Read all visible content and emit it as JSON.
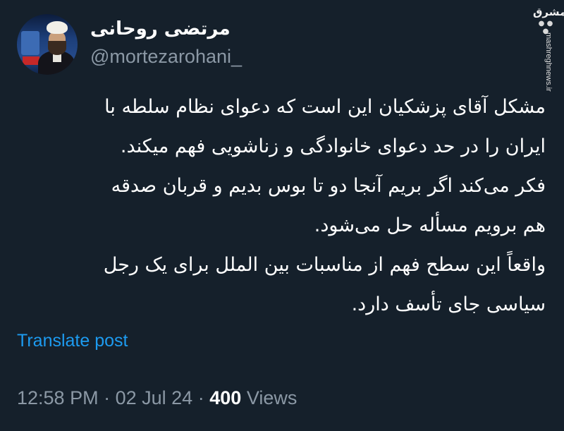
{
  "author": {
    "display_name": "مرتضی روحانی",
    "handle": "@mortezarohani_"
  },
  "watermark": {
    "logo": "مشرق",
    "url": "mashreghnews.ir"
  },
  "post": {
    "lines": [
      "مشکل آقای پزشکیان این است که دعوای نظام سلطه با",
      "ایران را در حد دعوای خانوادگی و زناشویی فهم میکند.",
      "فکر می‌کند اگر بریم آنجا دو تا بوس بدیم و قربان صدقه",
      "هم برویم مسأله حل می‌شود.",
      "واقعاً این سطح فهم از مناسبات بین الملل برای یک رجل",
      "سیاسی جای تأسف دارد."
    ]
  },
  "translate_label": "Translate post",
  "meta": {
    "time": "12:58 PM",
    "separator": "·",
    "date": "02 Jul 24",
    "views_count": "400",
    "views_label": "Views"
  },
  "colors": {
    "background": "#15202b",
    "link": "#1d9bf0",
    "secondary": "#8b98a5"
  }
}
